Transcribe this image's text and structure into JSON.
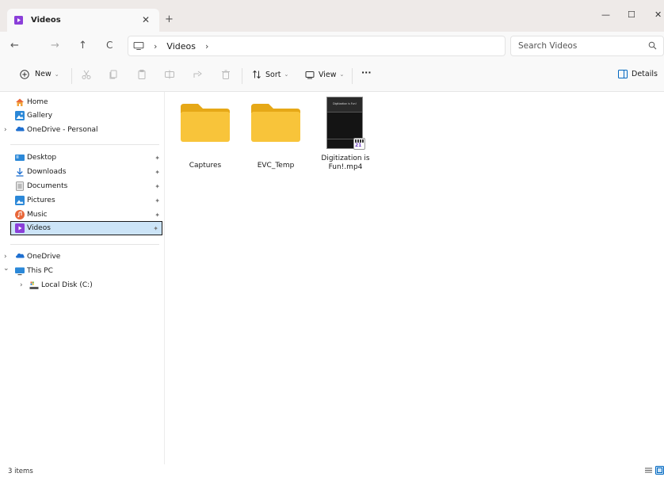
{
  "tab": {
    "label": "Videos",
    "close": "✕",
    "new_tab": "+"
  },
  "window": {
    "minimize": "—",
    "maximize": "☐",
    "close": "✕"
  },
  "nav": {
    "back": "←",
    "forward": "→",
    "up": "↑",
    "refresh": "C"
  },
  "address": {
    "separator": "›",
    "crumbs": [
      "Videos",
      "›"
    ]
  },
  "search": {
    "placeholder": "Search Videos"
  },
  "commands": {
    "new_label": "New",
    "sort_label": "Sort",
    "view_label": "View",
    "more_label": "···",
    "details_label": "Details",
    "caret": "⌄"
  },
  "sidebar": {
    "home": "Home",
    "gallery": "Gallery",
    "onedrive_personal": "OneDrive - Personal",
    "quick_access": [
      {
        "label": "Desktop"
      },
      {
        "label": "Downloads"
      },
      {
        "label": "Documents"
      },
      {
        "label": "Pictures"
      },
      {
        "label": "Music"
      },
      {
        "label": "Videos"
      }
    ],
    "onedrive": "OneDrive",
    "this_pc": "This PC",
    "local_disk": "Local Disk (C:)",
    "chevron_right": "›",
    "chevron_down": "⌄",
    "pin": "📌"
  },
  "files": [
    {
      "name": "Captures",
      "type": "folder"
    },
    {
      "name": "EVC_Temp",
      "type": "folder"
    },
    {
      "name": "Digitization is Fun!.mp4",
      "type": "video",
      "thumb_title": "Digitization is Fun!",
      "badge": "21"
    }
  ],
  "status": {
    "count": "3 items"
  },
  "colors": {
    "folder": "#f8c43a",
    "folder_dark": "#e6a817",
    "selected_bg": "#cce4f7",
    "videos_icon": "#8b3fd9",
    "onedrive": "#1e6fd0"
  }
}
